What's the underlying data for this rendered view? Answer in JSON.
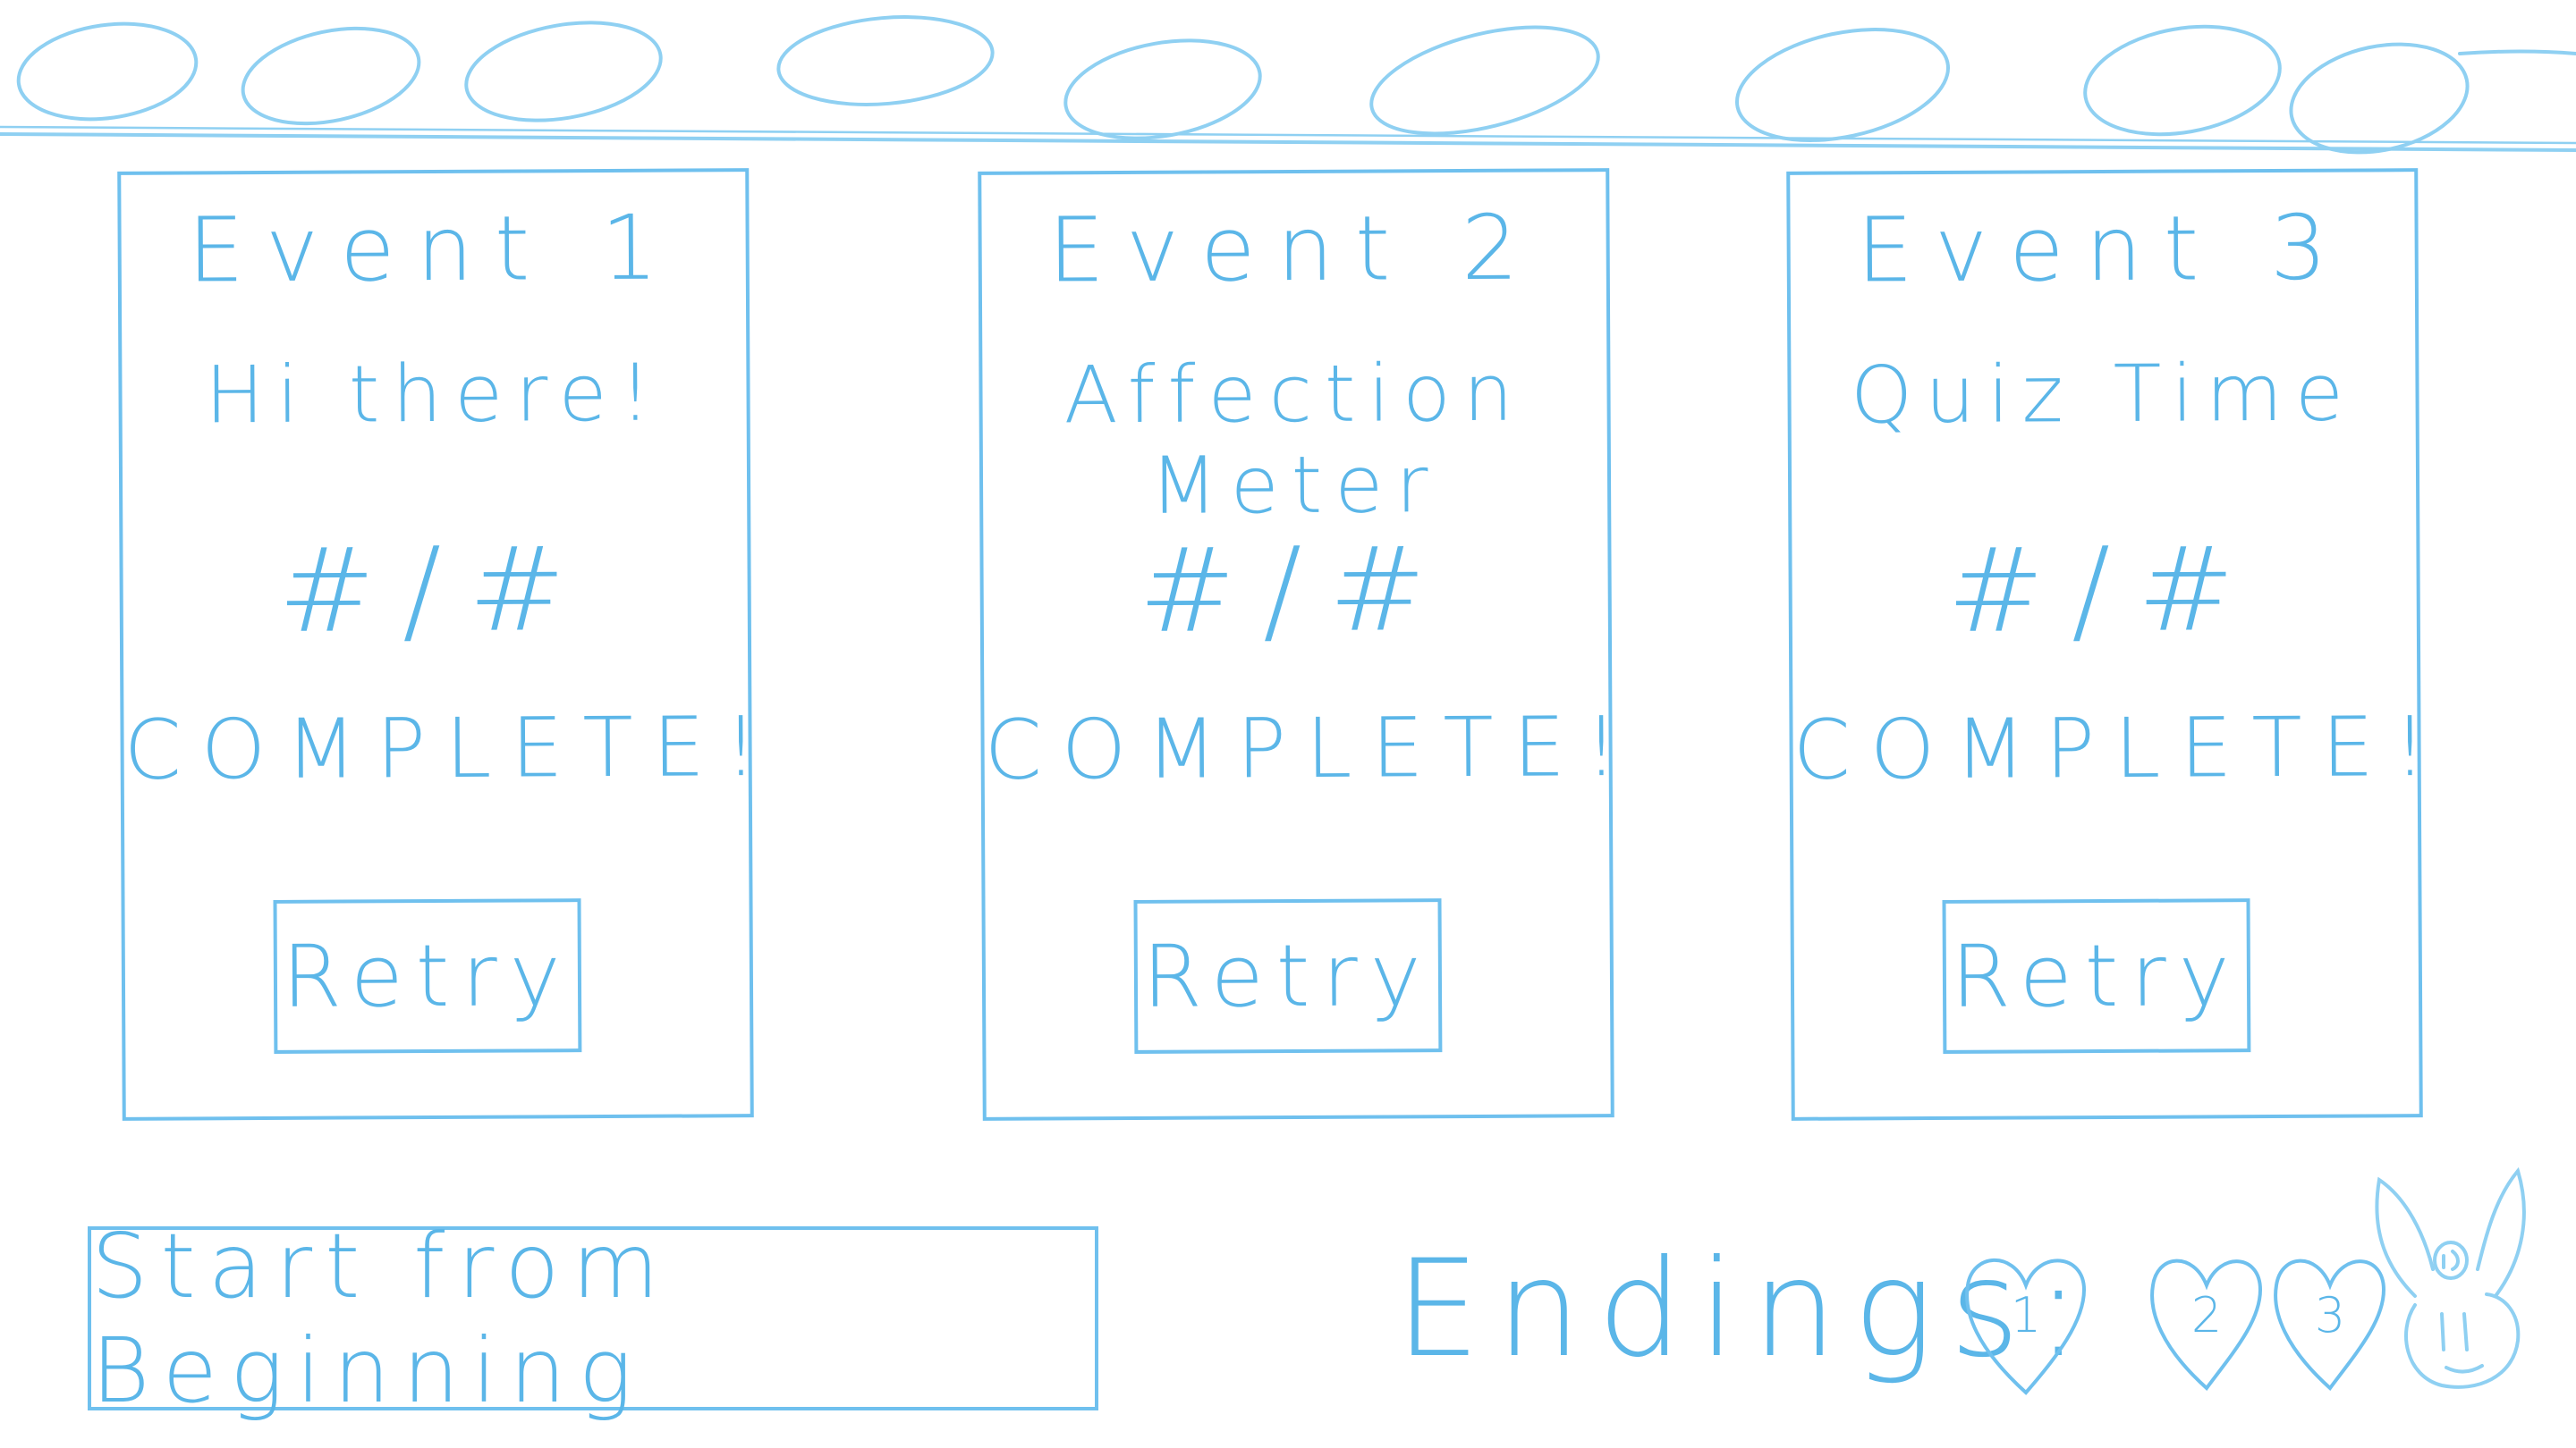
{
  "events": [
    {
      "title": "Event 1",
      "subtitle": "Hi there!",
      "counter": "#/#",
      "status": "COMPLETE!",
      "retry_label": "Retry"
    },
    {
      "title": "Event 2",
      "subtitle": "Affection Meter",
      "counter": "#/#",
      "status": "COMPLETE!",
      "retry_label": "Retry"
    },
    {
      "title": "Event 3",
      "subtitle": "Quiz Time",
      "counter": "#/#",
      "status": "COMPLETE!",
      "retry_label": "Retry"
    }
  ],
  "start_button_label": "Start from Beginning",
  "endings": {
    "label": "Endings:",
    "items": [
      "1",
      "2",
      "3"
    ]
  },
  "icons": {
    "header": "scribble-loops",
    "endings": "heart-icon",
    "mascot": "bunny-icon"
  },
  "colors": {
    "ink": "#5bb6e8",
    "background": "#ffffff"
  }
}
